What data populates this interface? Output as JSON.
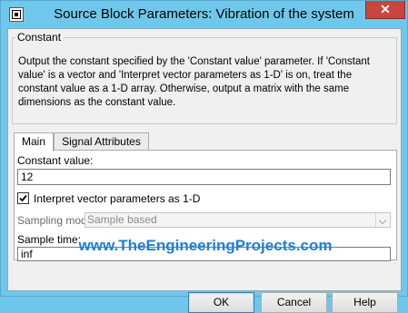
{
  "window": {
    "title": "Source Block Parameters: Vibration of the system",
    "close_glyph": "✕",
    "app_icon": "simulink-block-icon"
  },
  "group": {
    "legend": "Constant",
    "description": "Output the constant specified by the 'Constant value' parameter. If 'Constant value' is a vector and 'Interpret vector parameters as 1-D' is on, treat the constant value as a 1-D array. Otherwise, output a matrix with the same dimensions as the constant value."
  },
  "tabs": [
    {
      "label": "Main",
      "active": true
    },
    {
      "label": "Signal Attributes",
      "active": false
    }
  ],
  "main": {
    "constant_value_label": "Constant value:",
    "constant_value": "12",
    "interpret_label": "Interpret vector parameters as 1-D",
    "interpret_checked": true,
    "sampling_mode_label": "Sampling mode:",
    "sampling_mode_value": "Sample based",
    "sample_time_label": "Sample time:",
    "sample_time": "inf"
  },
  "watermark": "www.TheEngineeringProjects.com",
  "buttons": {
    "ok": "OK",
    "cancel": "Cancel",
    "help": "Help"
  },
  "colors": {
    "titlebar": "#6fc8ec",
    "close": "#c7463e",
    "watermark": "#1f7fd4"
  }
}
